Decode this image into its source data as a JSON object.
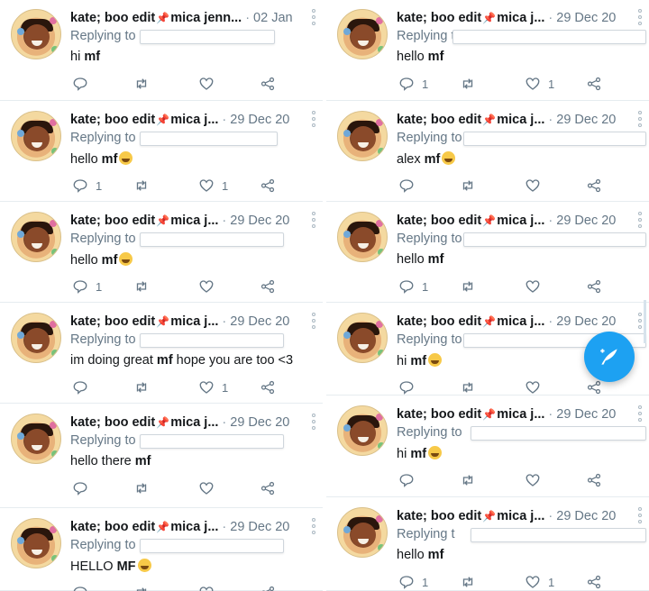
{
  "colors": {
    "accent": "#1da1f2",
    "pin": "#e0245e",
    "muted": "#657786",
    "text": "#14171a"
  },
  "icons": {
    "reply": "reply-icon",
    "retweet": "retweet-icon",
    "like": "heart-icon",
    "share": "share-icon",
    "more": "more-vertical-icon",
    "compose": "compose-feather-icon"
  },
  "left": [
    {
      "name": "kate; boo edit",
      "name_suffix": "mica jenn...",
      "date": "02 Jan",
      "replying": "Replying to",
      "text_pre": "hi ",
      "text_bold": "mf",
      "text_post": "",
      "emoji": false,
      "reply_count": "",
      "like_count": ""
    },
    {
      "name": "kate; boo edit",
      "name_suffix": "mica j...",
      "date": "29 Dec 20",
      "replying": "Replying to",
      "text_pre": "hello ",
      "text_bold": "mf",
      "text_post": "",
      "emoji": true,
      "reply_count": "1",
      "like_count": "1"
    },
    {
      "name": "kate; boo edit",
      "name_suffix": "mica j...",
      "date": "29 Dec 20",
      "replying": "Replying to",
      "text_pre": "hello ",
      "text_bold": "mf",
      "text_post": "",
      "emoji": true,
      "reply_count": "1",
      "like_count": ""
    },
    {
      "name": "kate; boo edit",
      "name_suffix": "mica j...",
      "date": "29 Dec 20",
      "replying": "Replying to",
      "text_pre": "im doing great ",
      "text_bold": "mf",
      "text_post": " hope you are too <3",
      "emoji": false,
      "reply_count": "",
      "like_count": "1"
    },
    {
      "name": "kate; boo edit",
      "name_suffix": "mica j...",
      "date": "29 Dec 20",
      "replying": "Replying to",
      "text_pre": "hello there ",
      "text_bold": "mf",
      "text_post": "",
      "emoji": false,
      "reply_count": "",
      "like_count": ""
    },
    {
      "name": "kate; boo edit",
      "name_suffix": "mica j...",
      "date": "29 Dec 20",
      "replying": "Replying to",
      "text_pre": "HELLO ",
      "text_bold": "MF",
      "text_post": "",
      "emoji": true,
      "reply_count": "",
      "like_count": ""
    }
  ],
  "right": [
    {
      "name": "kate; boo edit",
      "name_suffix": "mica j...",
      "date": "29 Dec 20",
      "replying": "Replying t",
      "text_pre": "hello ",
      "text_bold": "mf",
      "text_post": "",
      "emoji": false,
      "reply_count": "1",
      "like_count": "1"
    },
    {
      "name": "kate; boo edit",
      "name_suffix": "mica j...",
      "date": "29 Dec 20",
      "replying": "Replying to",
      "text_pre": "alex ",
      "text_bold": "mf",
      "text_post": "",
      "emoji": true,
      "reply_count": "",
      "like_count": ""
    },
    {
      "name": "kate; boo edit",
      "name_suffix": "mica j...",
      "date": "29 Dec 20",
      "replying": "Replying to",
      "text_pre": "hello ",
      "text_bold": "mf",
      "text_post": "",
      "emoji": false,
      "reply_count": "1",
      "like_count": ""
    },
    {
      "name": "kate; boo edit",
      "name_suffix": "mica j...",
      "date": "29 Dec 20",
      "replying": "Replying to",
      "text_pre": "hi ",
      "text_bold": "mf",
      "text_post": "",
      "emoji": true,
      "reply_count": "",
      "like_count": ""
    },
    {
      "name": "kate; boo edit",
      "name_suffix": "mica j...",
      "date": "29 Dec 20",
      "replying": "Replying to",
      "text_pre": "hi ",
      "text_bold": "mf",
      "text_post": "",
      "emoji": true,
      "reply_count": "",
      "like_count": ""
    },
    {
      "name": "kate; boo edit",
      "name_suffix": "mica j...",
      "date": "29 Dec 20",
      "replying": "Replying t",
      "text_pre": "hello ",
      "text_bold": "mf",
      "text_post": "",
      "emoji": false,
      "reply_count": "1",
      "like_count": "1"
    }
  ]
}
